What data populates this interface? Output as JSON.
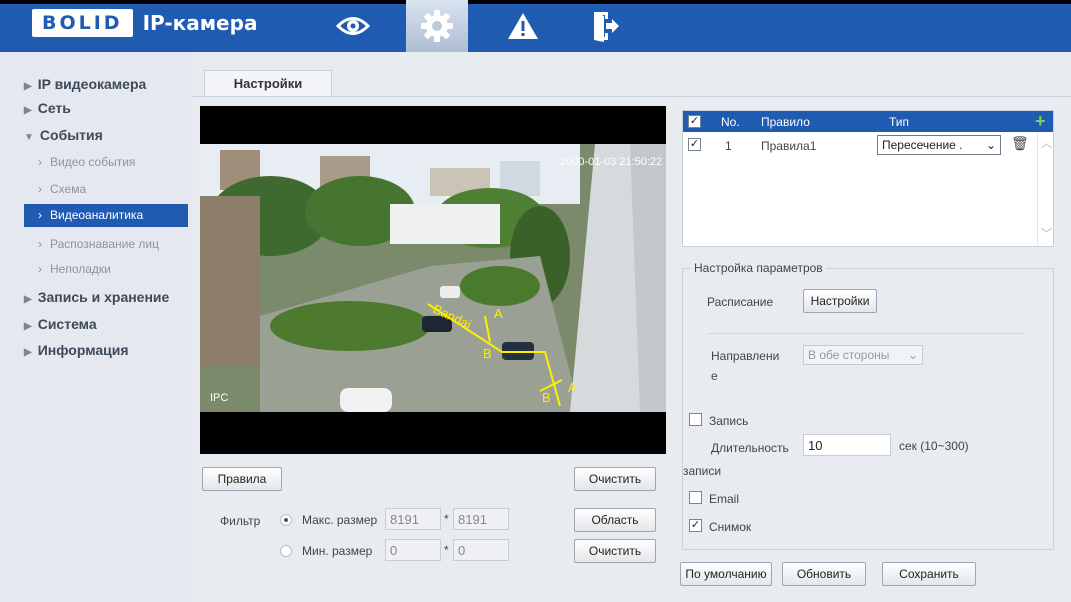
{
  "app": {
    "logo": "BOLID",
    "title": "IP-камера"
  },
  "topnav": [
    {
      "icon": "eye-icon"
    },
    {
      "icon": "gear-icon"
    },
    {
      "icon": "warning-icon"
    },
    {
      "icon": "exit-icon"
    }
  ],
  "sidebar": {
    "items": [
      {
        "label": "IP видеокамера"
      },
      {
        "label": "Сеть"
      },
      {
        "label": "События"
      },
      {
        "label": "Запись и хранение"
      },
      {
        "label": "Система"
      },
      {
        "label": "Информация"
      }
    ],
    "sub_items": [
      {
        "label": "Видео события"
      },
      {
        "label": "Схема"
      },
      {
        "label": "Видеоаналитика"
      },
      {
        "label": "Распознавание лиц"
      },
      {
        "label": "Неполадки"
      }
    ]
  },
  "main": {
    "tab": "Настройки",
    "video": {
      "timestamp": "2000-01-03 21:50:22",
      "channel": "IPC"
    },
    "buttons": {
      "rules": "Правила",
      "clear": "Очистить",
      "area": "Область",
      "clear2": "Очистить"
    },
    "filter": {
      "label": "Фильтр",
      "max_label": "Макс. размер",
      "max_w": "8191",
      "max_h": "8191",
      "min_label": "Мин. размер",
      "min_w": "0",
      "min_h": "0",
      "sep": "*"
    },
    "rules_table": {
      "headers": {
        "no": "No.",
        "rule": "Правило",
        "type": "Тип"
      },
      "rows": [
        {
          "no": "1",
          "rule": "Правила1",
          "type": "Пересечение ."
        }
      ]
    },
    "params": {
      "legend": "Настройка параметров",
      "schedule_label": "Расписание",
      "schedule_button": "Настройки",
      "direction_label_1": "Направлени",
      "direction_label_2": "е",
      "direction_value": "В обе стороны",
      "record_label": "Запись",
      "duration_label_1": "Длительность",
      "duration_label_2": "записи",
      "duration_value": "10",
      "duration_unit": "сек (10~300)",
      "email_label": "Email",
      "snapshot_label": "Снимок"
    },
    "footer": {
      "default": "По умолчанию",
      "refresh": "Обновить",
      "save": "Сохранить"
    }
  }
}
